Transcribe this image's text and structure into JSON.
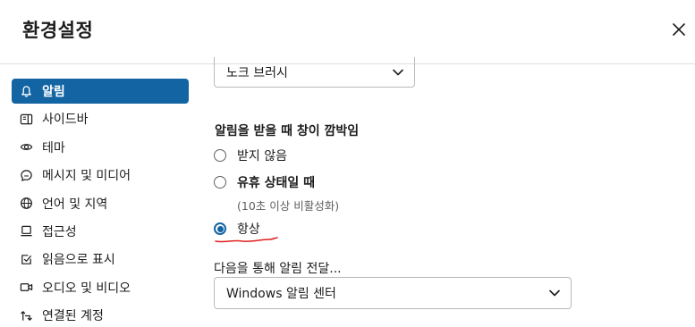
{
  "dialog": {
    "title": "환경설정",
    "close_icon": "close-icon"
  },
  "sidebar": {
    "items": [
      {
        "label": "알림",
        "icon": "bell-icon",
        "active": true
      },
      {
        "label": "사이드바",
        "icon": "sidebar-panel-icon",
        "active": false
      },
      {
        "label": "테마",
        "icon": "eye-icon",
        "active": false
      },
      {
        "label": "메시지 및 미디어",
        "icon": "message-icon",
        "active": false
      },
      {
        "label": "언어 및 지역",
        "icon": "globe-icon",
        "active": false
      },
      {
        "label": "접근성",
        "icon": "laptop-icon",
        "active": false
      },
      {
        "label": "읽음으로 표시",
        "icon": "check-square-icon",
        "active": false
      },
      {
        "label": "오디오 및 비디오",
        "icon": "video-icon",
        "active": false
      },
      {
        "label": "연결된 계정",
        "icon": "link-arrows-icon",
        "active": false
      }
    ]
  },
  "main": {
    "sound_select": {
      "value": "노크 브러시"
    },
    "flash_section": {
      "label": "알림을 받을 때 창이 깜박임",
      "options": [
        {
          "label": "받지 않음",
          "checked": false
        },
        {
          "label": "유휴 상태일 때",
          "checked": false,
          "note": "(10초 이상 비활성화)"
        },
        {
          "label": "항상",
          "checked": true
        }
      ]
    },
    "deliver": {
      "label": "다음을 통해 알림 전달...",
      "value": "Windows 알림 센터"
    }
  },
  "colors": {
    "accent": "#1264a3",
    "annotation": "#e01e1e",
    "border": "#b9b9b9"
  }
}
